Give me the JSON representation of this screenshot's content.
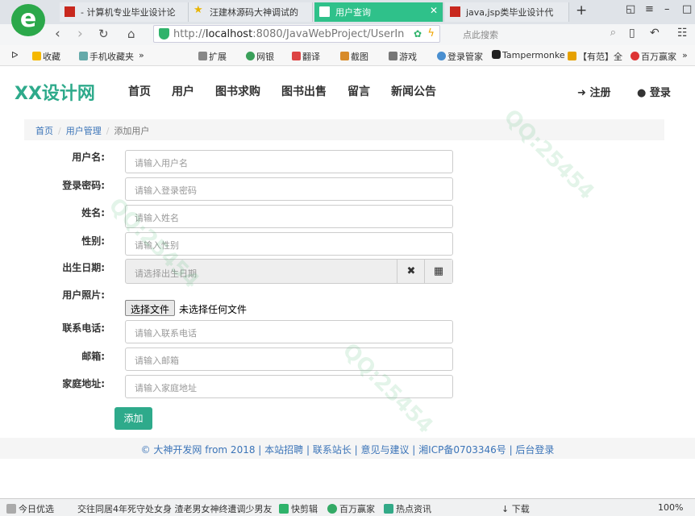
{
  "browser": {
    "logo_letter": "e",
    "tabs": [
      {
        "label": "- 计算机专业毕业设计论",
        "active": false,
        "icon": "red-square-icon"
      },
      {
        "label": "汪建林源码大神调试的",
        "active": false,
        "icon": "star-icon"
      },
      {
        "label": "用户查询",
        "active": true,
        "icon": "page-icon"
      },
      {
        "label": "java,jsp类毕业设计代",
        "active": false,
        "icon": "red-square-icon"
      }
    ],
    "new_tab": "+",
    "url_prefix": "http://",
    "url_host": "localhost",
    "url_rest": ":8080/JavaWebProject/UserIn",
    "search_placeholder": "点此搜索",
    "bookmarks": [
      "收藏",
      "手机收藏夹",
      "扩展",
      "网银",
      "翻译",
      "截图",
      "游戏",
      "登录管家",
      "Tampermonke",
      "【有范】全",
      "百万赢家"
    ],
    "bookmark_more": "»"
  },
  "site": {
    "logo": "XX设计网",
    "menu": [
      "首页",
      "用户",
      "图书求购",
      "图书出售",
      "留言",
      "新闻公告"
    ],
    "register": "注册",
    "login": "登录"
  },
  "breadcrumb": {
    "home": "首页",
    "section": "用户管理",
    "current": "添加用户"
  },
  "form": {
    "username_label": "用户名:",
    "username_placeholder": "请输入用户名",
    "password_label": "登录密码:",
    "password_placeholder": "请输入登录密码",
    "name_label": "姓名:",
    "name_placeholder": "请输入姓名",
    "gender_label": "性别:",
    "gender_placeholder": "请输入性别",
    "birthday_label": "出生日期:",
    "birthday_placeholder": "请选择出生日期",
    "photo_label": "用户照片:",
    "file_button": "选择文件",
    "file_status": "未选择任何文件",
    "phone_label": "联系电话:",
    "phone_placeholder": "请输入联系电话",
    "email_label": "邮箱:",
    "email_placeholder": "请输入邮箱",
    "address_label": "家庭地址:",
    "address_placeholder": "请输入家庭地址",
    "submit": "添加"
  },
  "footer": "© 大神开发网 from 2018 | 本站招聘 | 联系站长 | 意见与建议 | 湘ICP备0703346号 | 后台登录",
  "statusbar": {
    "items": [
      "今日优选",
      "交往同居4年死守处女身 渣老男女神终遭调少男友",
      "快剪辑",
      "百万赢家",
      "热点资讯",
      "下载"
    ],
    "zoom": "100%"
  },
  "watermarks": [
    "QQ:25454"
  ]
}
